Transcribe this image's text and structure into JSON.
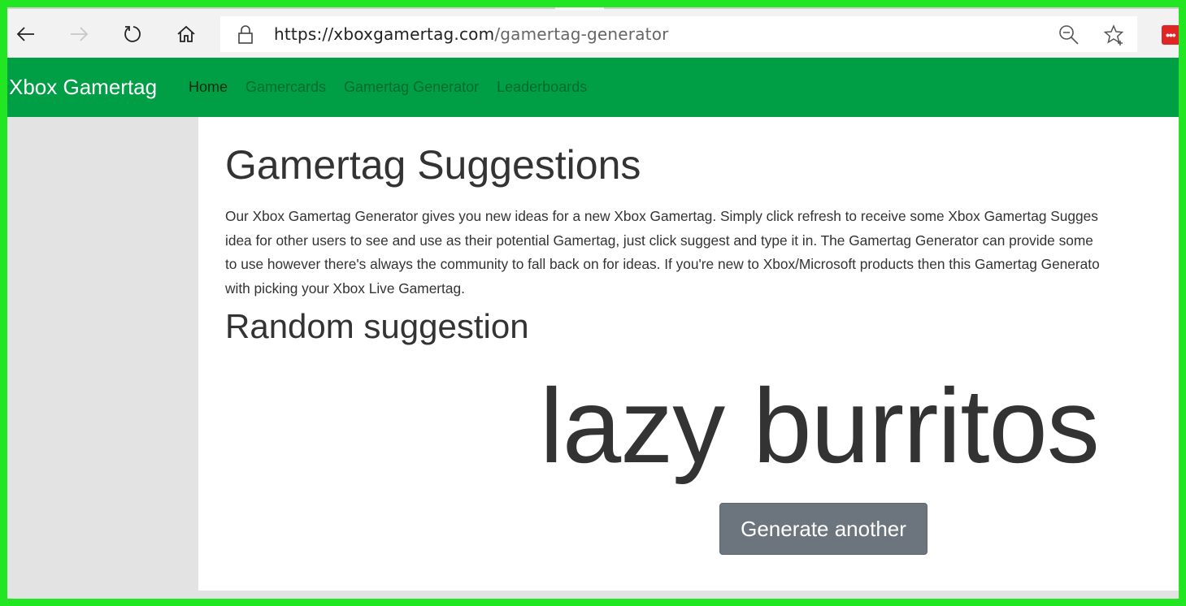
{
  "browser": {
    "url_host": "https://xboxgamertag.com",
    "url_path": "/gamertag-generator",
    "icons": {
      "back": "arrow-left-icon",
      "forward": "arrow-right-icon",
      "refresh": "refresh-icon",
      "home": "home-icon",
      "lock": "lock-icon",
      "zoom_out": "zoom-out-icon",
      "favorite": "star-plus-icon",
      "extension": "more-dots-icon"
    },
    "extension_label": "•••"
  },
  "navbar": {
    "brand": "Xbox Gamertag",
    "links": [
      {
        "label": "Home",
        "active": true
      },
      {
        "label": "Gamercards",
        "active": false
      },
      {
        "label": "Gamertag Generator",
        "active": false
      },
      {
        "label": "Leaderboards",
        "active": false
      }
    ],
    "color": "#009e45"
  },
  "main": {
    "title": "Gamertag Suggestions",
    "intro_lines": [
      "Our Xbox Gamertag Generator gives you new ideas for a new Xbox Gamertag. Simply click refresh to receive some Xbox Gamertag Sugges",
      "idea for other users to see and use as their potential Gamertag, just click suggest and type it in. The Gamertag Generator can provide some",
      "to use however there's always the community to fall back on for ideas. If you're new to Xbox/Microsoft products then this Gamertag Generato",
      "with picking your Xbox Live Gamertag."
    ],
    "subtitle": "Random suggestion",
    "suggestion": "lazy burritos",
    "generate_button": "Generate another"
  }
}
